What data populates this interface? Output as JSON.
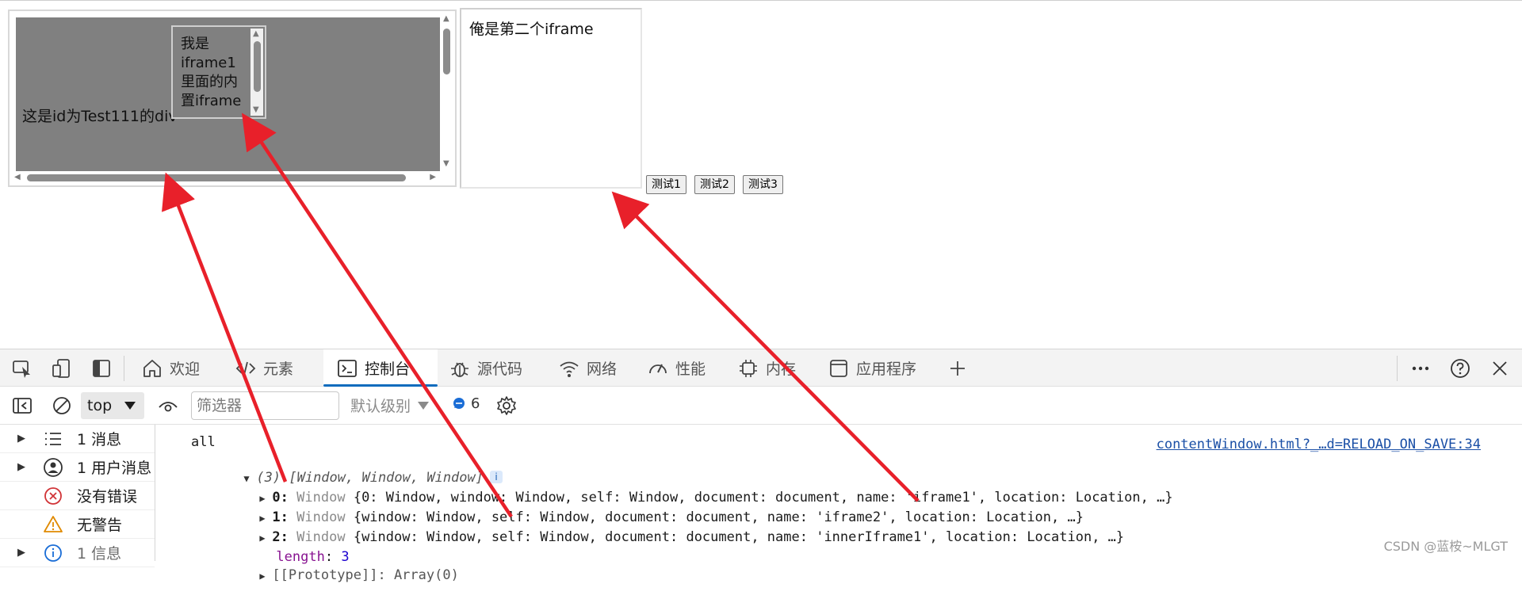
{
  "page": {
    "div_text": "这是id为Test111的div",
    "inner_iframe_text": "我是iframe1里面的内置iframe",
    "iframe2_text": "俺是第二个iframe",
    "buttons": [
      "测试1",
      "测试2",
      "测试3"
    ]
  },
  "devtools": {
    "tabs": [
      {
        "label": "欢迎",
        "icon": "home-icon"
      },
      {
        "label": "元素",
        "icon": "code-brackets-icon"
      },
      {
        "label": "控制台",
        "icon": "console-icon",
        "active": true
      },
      {
        "label": "源代码",
        "icon": "bug-icon"
      },
      {
        "label": "网络",
        "icon": "wifi-icon"
      },
      {
        "label": "性能",
        "icon": "gauge-icon"
      },
      {
        "label": "内存",
        "icon": "chip-icon"
      },
      {
        "label": "应用程序",
        "icon": "app-window-icon"
      }
    ],
    "toolbar": {
      "context": "top",
      "filter_placeholder": "筛选器",
      "levels": "默认级别",
      "issues_count": "6"
    },
    "sidebar": [
      {
        "label": "1 消息",
        "icon": "list-icon"
      },
      {
        "label": "1 用户消息",
        "icon": "user-icon"
      },
      {
        "label": "没有错误",
        "icon": "error-circle-icon"
      },
      {
        "label": "无警告",
        "icon": "warning-icon"
      },
      {
        "label": "1 信息",
        "icon": "info-icon"
      }
    ],
    "console": {
      "source_link": "contentWindow.html?_…d=RELOAD_ON_SAVE:34",
      "log_text": "all",
      "array_summary": "(3) [Window, Window, Window]",
      "items": [
        {
          "index": "0",
          "type": "Window",
          "body": "{0: Window, window: Window, self: Window, document: document, name: 'iframe1', location: Location, …}"
        },
        {
          "index": "1",
          "type": "Window",
          "body": "{window: Window, self: Window, document: document, name: 'iframe2', location: Location, …}"
        },
        {
          "index": "2",
          "type": "Window",
          "body": "{window: Window, self: Window, document: document, name: 'innerIframe1', location: Location, …}"
        }
      ],
      "length_key": "length",
      "length_value": "3",
      "prototype_line": "[[Prototype]]: Array(0)"
    }
  },
  "watermark": "CSDN @蓝桉~MLGT",
  "colors": {
    "arrow": "#e8202a",
    "active_tab_underline": "#0f6cbd",
    "iframe_bg": "#808080"
  }
}
